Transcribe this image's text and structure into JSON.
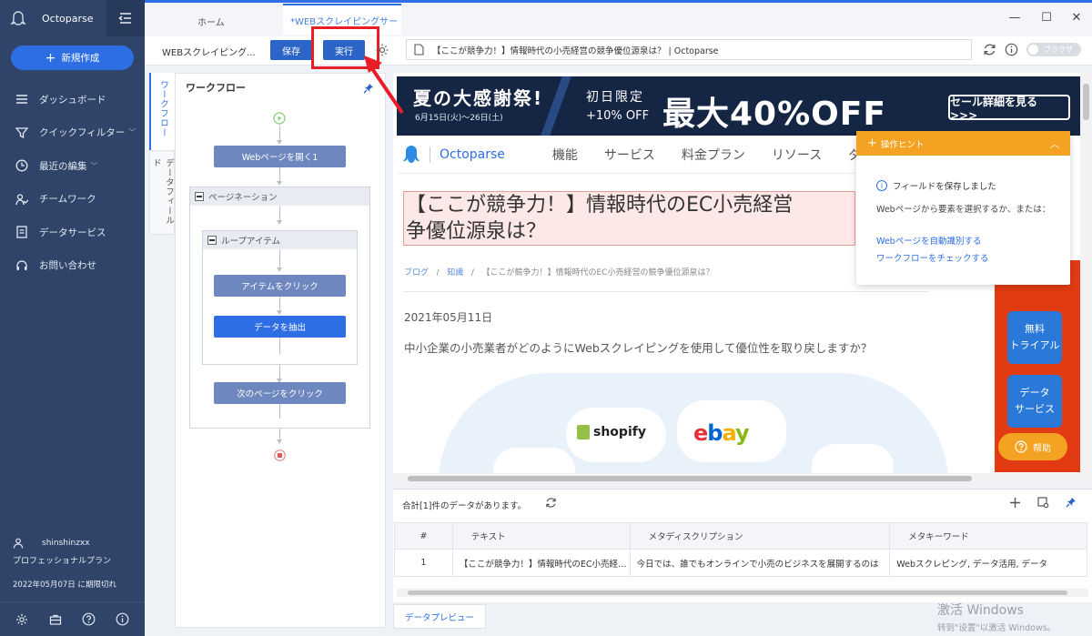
{
  "app": {
    "name": "Octoparse",
    "new_task": "新規作成"
  },
  "sidebar": {
    "items": [
      {
        "label": "ダッシュボード",
        "icon": "list-icon",
        "chevron": false
      },
      {
        "label": "クイックフィルター",
        "icon": "filter-icon",
        "chevron": true
      },
      {
        "label": "最近の編集",
        "icon": "clock-icon",
        "chevron": true
      },
      {
        "label": "チームワーク",
        "icon": "team-icon",
        "chevron": false
      },
      {
        "label": "データサービス",
        "icon": "document-icon",
        "chevron": false
      },
      {
        "label": "お問い合わせ",
        "icon": "headset-icon",
        "chevron": false
      }
    ],
    "user": {
      "name": "shinshinzxx",
      "plan": "プロフェッショナルプラン",
      "expire": "2022年05月07日 に期限切れ"
    }
  },
  "tabs": {
    "home": "ホーム",
    "active": "*WEBスクレイピングサービス"
  },
  "toolbar": {
    "task_name": "WEBスクレイピング...",
    "save": "保存",
    "run": "実行",
    "url_title": "【ここが競争力！】情報時代の小売経営の競争優位源泉は？ | Octoparse",
    "browser_toggle": "ブラウザ"
  },
  "side_tabs": {
    "workflow": "ワークフロー",
    "data_field": "データフィールド"
  },
  "workflow": {
    "title": "ワークフロー",
    "open_page": "Webページを開く1",
    "pagination": "ページネーション",
    "loop_item": "ループアイテム",
    "click_item": "アイテムをクリック",
    "extract": "データを抽出",
    "next_page": "次のページをクリック"
  },
  "page": {
    "banner": {
      "sale": "夏の大感謝祭!",
      "dates": "6月15日(火)～26日(土)",
      "first_day": "初日限定",
      "extra": "+10% OFF",
      "big": "最大40%OFF",
      "cta": "セール詳細を見る >>>"
    },
    "logo": "Octoparse",
    "nav": [
      "機能",
      "サービス",
      "料金プラン",
      "リソース",
      "ダ"
    ],
    "article_title_1": "【ここが競争力！】情報時代のEC小売経営",
    "article_title_2": "争優位源泉は？",
    "crumb_blog": "ブログ",
    "crumb_knowledge": "知識",
    "crumb_current": "【ここが競争力！】情報時代のEC小売経営の競争優位源泉は？",
    "date": "2021年05月11日",
    "lead": "中小企業の小売業者がどのようにWebスクレイピングを使用して優位性を取り戻しますか？",
    "shopify": "shopify",
    "ebay": [
      "e",
      "b",
      "a",
      "y"
    ],
    "ebay_colors": [
      "#e53238",
      "#0064d2",
      "#f5af02",
      "#86b817"
    ],
    "ad_trial": "無料\nトライアル",
    "ad_data": "データ\nサービス",
    "help": "帮助"
  },
  "hint": {
    "title": "操作ヒント",
    "saved": "フィールドを保存しました",
    "text": "Webページから要素を選択するか、または：",
    "link1": "Webページを自動識別する",
    "link2": "ワークフローをチェックする"
  },
  "data": {
    "count": "合計[1]件のデータがあります。",
    "columns": [
      "#",
      "テキスト",
      "メタディスクリプション",
      "メタキーワード"
    ],
    "rows": [
      [
        "1",
        "【ここが競争力！】情報時代のEC小売経営の競争優位源泉は？",
        "今日では、誰でもオンラインで小売のビジネスを展開するのは",
        "Webスクレピング, データ活用, データ"
      ]
    ],
    "preview_tab": "データプレビュー"
  },
  "watermark": {
    "line1": "激活 Windows",
    "line2": "转到\"设置\"以激活 Windows。"
  },
  "colors": {
    "sidebar": "#2f4468",
    "primary": "#2d6ee5",
    "highlight": "#e81d25",
    "hint": "#f3a321"
  }
}
